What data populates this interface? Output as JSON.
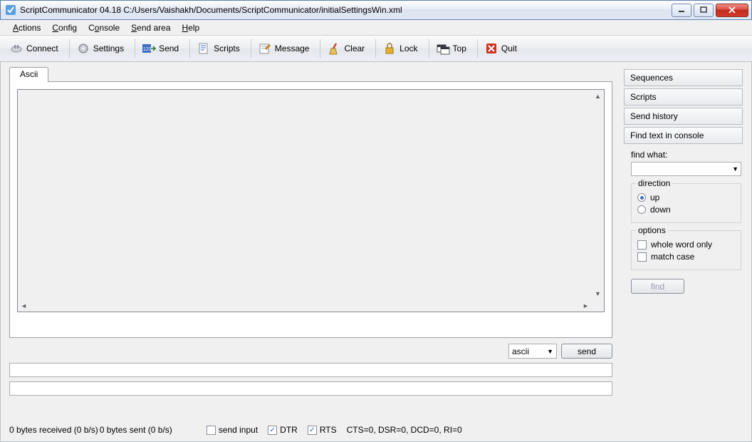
{
  "title": "ScriptCommunicator 04.18   C:/Users/Vaishakh/Documents/ScriptCommunicator/initialSettingsWin.xml",
  "menu": {
    "actions": "Actions",
    "config": "Config",
    "console": "Console",
    "sendarea": "Send area",
    "help": "Help"
  },
  "toolbar": {
    "connect": "Connect",
    "settings": "Settings",
    "send": "Send",
    "scripts": "Scripts",
    "message": "Message",
    "clear": "Clear",
    "lock": "Lock",
    "top": "Top",
    "quit": "Quit"
  },
  "tab": {
    "ascii": "Ascii"
  },
  "sendarea": {
    "format": "ascii",
    "send_btn": "send"
  },
  "status": {
    "received": "0 bytes received (0 b/s)",
    "sent": "0 bytes sent (0 b/s)",
    "sendinput": "send input",
    "dtr": "DTR",
    "rts": "RTS",
    "signals": "CTS=0, DSR=0, DCD=0, RI=0",
    "dtr_checked": true,
    "rts_checked": true,
    "sendinput_checked": false
  },
  "right": {
    "sequences": "Sequences",
    "scripts": "Scripts",
    "history": "Send history",
    "find": "Find text in console",
    "findwhat": "find what:",
    "direction": {
      "legend": "direction",
      "up": "up",
      "down": "down",
      "selected": "up"
    },
    "options": {
      "legend": "options",
      "whole": "whole word only",
      "match": "match case"
    },
    "findbtn": "find"
  }
}
